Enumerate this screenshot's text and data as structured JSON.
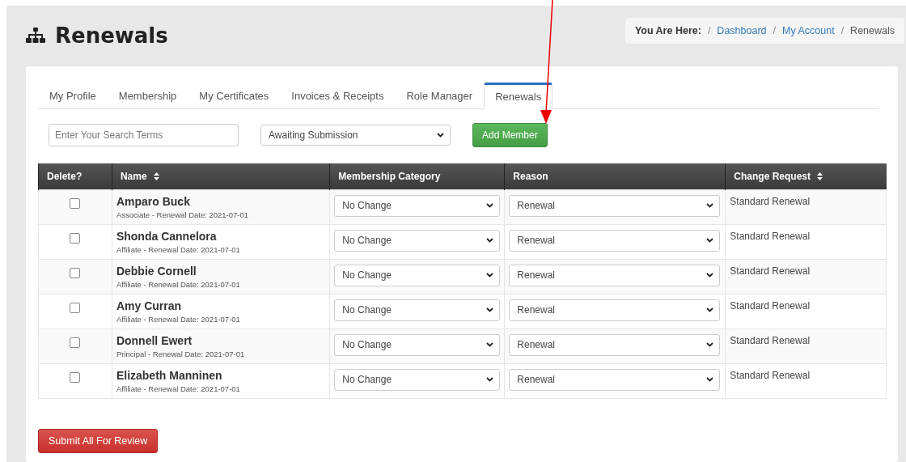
{
  "page_title": "Renewals",
  "breadcrumb": {
    "label": "You Are Here:",
    "separator": "/",
    "links": [
      "Dashboard",
      "My Account"
    ],
    "current": "Renewals"
  },
  "tabs": [
    {
      "label": "My Profile",
      "selected": false
    },
    {
      "label": "Membership",
      "selected": false
    },
    {
      "label": "My Certificates",
      "selected": false
    },
    {
      "label": "Invoices & Receipts",
      "selected": false
    },
    {
      "label": "Role Manager",
      "selected": false
    },
    {
      "label": "Renewals",
      "selected": true
    }
  ],
  "search": {
    "placeholder": "Enter Your Search Terms"
  },
  "status_filter": {
    "value": "Awaiting Submission"
  },
  "add_button": "Add Member",
  "table": {
    "columns": [
      {
        "label": "Delete?",
        "sortable": false
      },
      {
        "label": "Name",
        "sortable": true
      },
      {
        "label": "Membership Category",
        "sortable": false
      },
      {
        "label": "Reason",
        "sortable": false
      },
      {
        "label": "Change Request",
        "sortable": true
      }
    ],
    "rows": [
      {
        "checked": false,
        "name": "Amparo Buck",
        "detail": "Associate - Renewal Date: 2021-07-01",
        "category": "No Change",
        "reason": "Renewal",
        "change_request": "Standard Renewal"
      },
      {
        "checked": false,
        "name": "Shonda Cannelora",
        "detail": "Affiliate - Renewal Date: 2021-07-01",
        "category": "No Change",
        "reason": "Renewal",
        "change_request": "Standard Renewal"
      },
      {
        "checked": false,
        "name": "Debbie Cornell",
        "detail": "Affiliate - Renewal Date: 2021-07-01",
        "category": "No Change",
        "reason": "Renewal",
        "change_request": "Standard Renewal"
      },
      {
        "checked": false,
        "name": "Amy Curran",
        "detail": "Affiliate - Renewal Date: 2021-07-01",
        "category": "No Change",
        "reason": "Renewal",
        "change_request": "Standard Renewal"
      },
      {
        "checked": false,
        "name": "Donnell Ewert",
        "detail": "Principal - Renewal Date: 2021-07-01",
        "category": "No Change",
        "reason": "Renewal",
        "change_request": "Standard Renewal"
      },
      {
        "checked": false,
        "name": "Elizabeth Manninen",
        "detail": "Affiliate - Renewal Date: 2021-07-01",
        "category": "No Change",
        "reason": "Renewal",
        "change_request": "Standard Renewal"
      }
    ]
  },
  "submit_button": "Submit All For Review"
}
